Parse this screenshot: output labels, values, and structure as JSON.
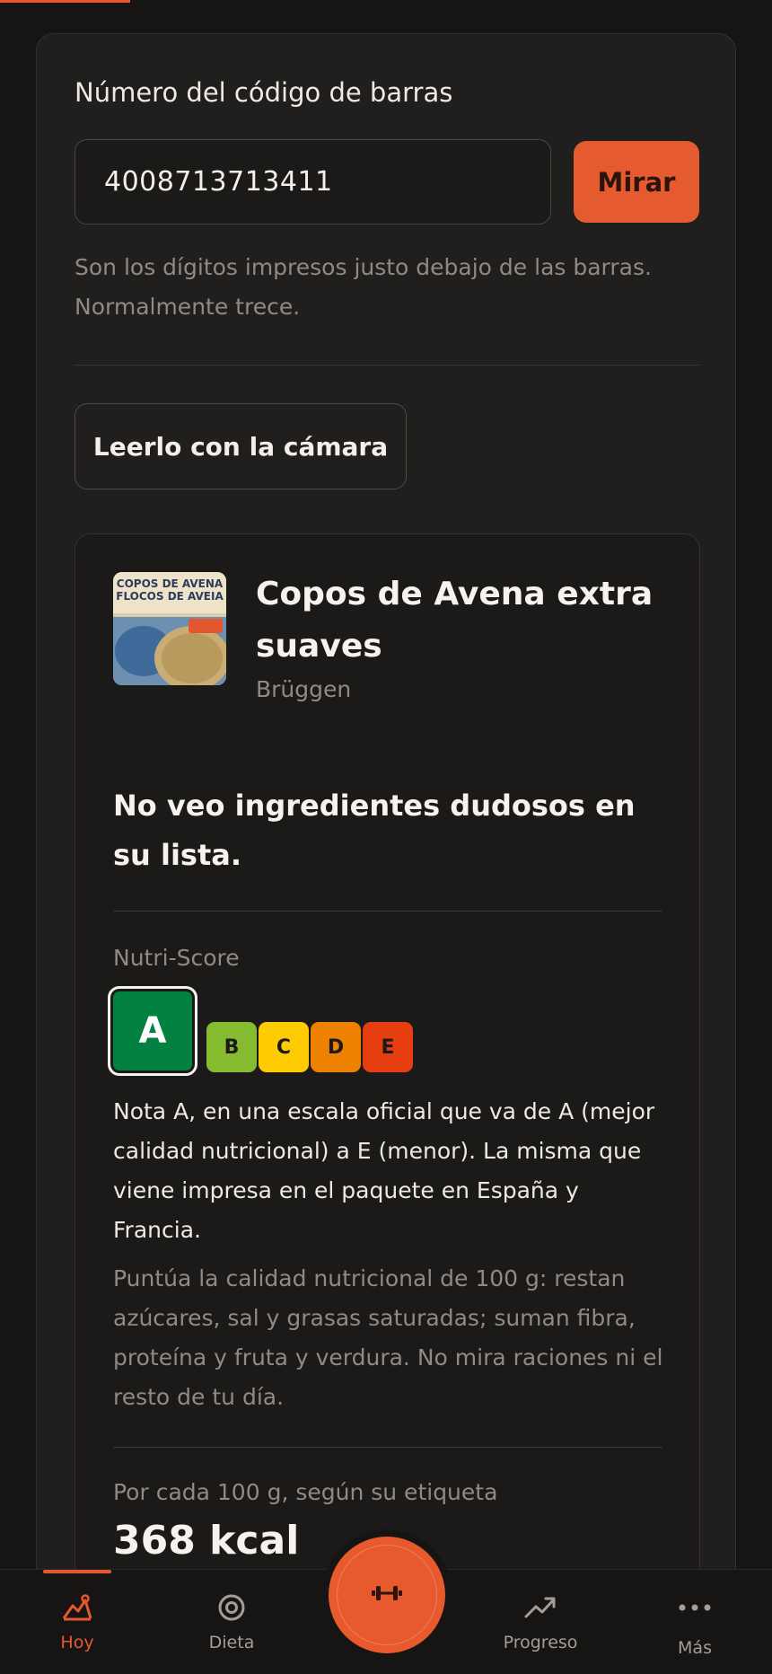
{
  "barcode": {
    "label": "Número del código de barras",
    "value": "4008713713411",
    "button": "Mirar",
    "hint": "Son los dígitos impresos justo debajo de las barras. Normalmente trece."
  },
  "camera_button": "Leerlo con la cámara",
  "product": {
    "name": "Copos de Avena extra suaves",
    "brand": "Brüggen",
    "thumb_lines": [
      "COPOS DE AVENA",
      "FLOCOS DE AVEIA"
    ],
    "ingredients_note": "No veo ingredientes dudosos en su lista.",
    "nutriscore": {
      "label": "Nutri-Score",
      "selected": "A",
      "grades": [
        {
          "letter": "A",
          "color": "#038141"
        },
        {
          "letter": "B",
          "color": "#85bb2f"
        },
        {
          "letter": "C",
          "color": "#fecb02"
        },
        {
          "letter": "D",
          "color": "#ee8100"
        },
        {
          "letter": "E",
          "color": "#e63e11"
        }
      ],
      "text": "Nota A, en una escala oficial que va de A (mejor calidad nutricional) a E (menor). La misma que viene impresa en el paquete en España y Francia.",
      "explanation": "Puntúa la calidad nutricional de 100 g: restan azúcares, sal y grasas saturadas; suman fibra, proteína y fruta y verdura. No mira raciones ni el resto de tu día."
    },
    "per_100g_label": "Por cada 100 g, según su etiqueta",
    "kcal": "368 kcal"
  },
  "tabs": [
    {
      "label": "Hoy",
      "icon": "mountain-chart-icon",
      "active": true
    },
    {
      "label": "Dieta",
      "icon": "target-icon",
      "active": false
    },
    {
      "label": "Progreso",
      "icon": "trend-up-icon",
      "active": false
    },
    {
      "label": "Más",
      "icon": "more-dots-icon",
      "active": false
    }
  ],
  "fab_icon": "dumbbell-icon",
  "colors": {
    "accent": "#e8582e",
    "background": "#161514",
    "card": "#201f1e"
  }
}
